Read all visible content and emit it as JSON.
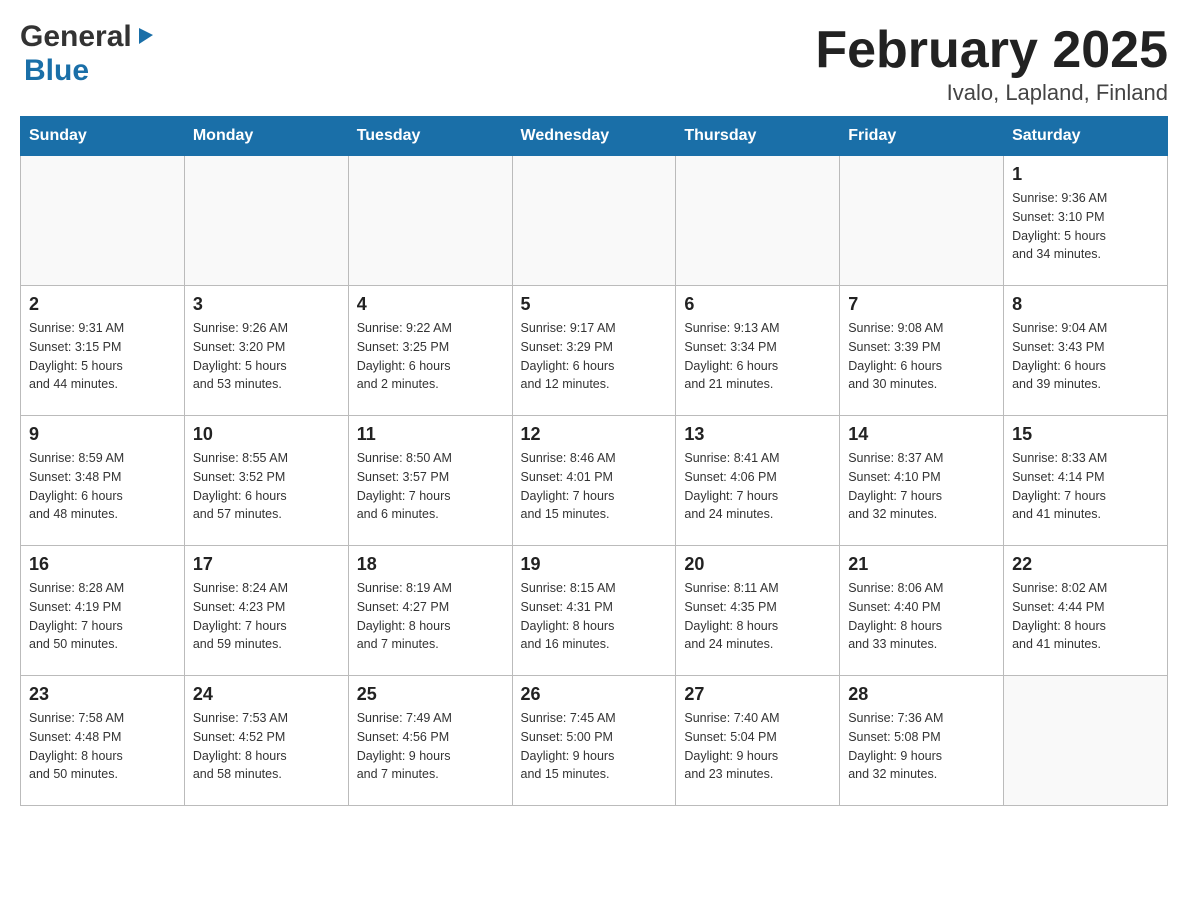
{
  "header": {
    "logo": {
      "general": "General",
      "blue": "Blue",
      "arrow_shape": "▶"
    },
    "title": "February 2025",
    "location": "Ivalo, Lapland, Finland"
  },
  "calendar": {
    "days_of_week": [
      "Sunday",
      "Monday",
      "Tuesday",
      "Wednesday",
      "Thursday",
      "Friday",
      "Saturday"
    ],
    "weeks": [
      [
        {
          "day": "",
          "info": ""
        },
        {
          "day": "",
          "info": ""
        },
        {
          "day": "",
          "info": ""
        },
        {
          "day": "",
          "info": ""
        },
        {
          "day": "",
          "info": ""
        },
        {
          "day": "",
          "info": ""
        },
        {
          "day": "1",
          "info": "Sunrise: 9:36 AM\nSunset: 3:10 PM\nDaylight: 5 hours\nand 34 minutes."
        }
      ],
      [
        {
          "day": "2",
          "info": "Sunrise: 9:31 AM\nSunset: 3:15 PM\nDaylight: 5 hours\nand 44 minutes."
        },
        {
          "day": "3",
          "info": "Sunrise: 9:26 AM\nSunset: 3:20 PM\nDaylight: 5 hours\nand 53 minutes."
        },
        {
          "day": "4",
          "info": "Sunrise: 9:22 AM\nSunset: 3:25 PM\nDaylight: 6 hours\nand 2 minutes."
        },
        {
          "day": "5",
          "info": "Sunrise: 9:17 AM\nSunset: 3:29 PM\nDaylight: 6 hours\nand 12 minutes."
        },
        {
          "day": "6",
          "info": "Sunrise: 9:13 AM\nSunset: 3:34 PM\nDaylight: 6 hours\nand 21 minutes."
        },
        {
          "day": "7",
          "info": "Sunrise: 9:08 AM\nSunset: 3:39 PM\nDaylight: 6 hours\nand 30 minutes."
        },
        {
          "day": "8",
          "info": "Sunrise: 9:04 AM\nSunset: 3:43 PM\nDaylight: 6 hours\nand 39 minutes."
        }
      ],
      [
        {
          "day": "9",
          "info": "Sunrise: 8:59 AM\nSunset: 3:48 PM\nDaylight: 6 hours\nand 48 minutes."
        },
        {
          "day": "10",
          "info": "Sunrise: 8:55 AM\nSunset: 3:52 PM\nDaylight: 6 hours\nand 57 minutes."
        },
        {
          "day": "11",
          "info": "Sunrise: 8:50 AM\nSunset: 3:57 PM\nDaylight: 7 hours\nand 6 minutes."
        },
        {
          "day": "12",
          "info": "Sunrise: 8:46 AM\nSunset: 4:01 PM\nDaylight: 7 hours\nand 15 minutes."
        },
        {
          "day": "13",
          "info": "Sunrise: 8:41 AM\nSunset: 4:06 PM\nDaylight: 7 hours\nand 24 minutes."
        },
        {
          "day": "14",
          "info": "Sunrise: 8:37 AM\nSunset: 4:10 PM\nDaylight: 7 hours\nand 32 minutes."
        },
        {
          "day": "15",
          "info": "Sunrise: 8:33 AM\nSunset: 4:14 PM\nDaylight: 7 hours\nand 41 minutes."
        }
      ],
      [
        {
          "day": "16",
          "info": "Sunrise: 8:28 AM\nSunset: 4:19 PM\nDaylight: 7 hours\nand 50 minutes."
        },
        {
          "day": "17",
          "info": "Sunrise: 8:24 AM\nSunset: 4:23 PM\nDaylight: 7 hours\nand 59 minutes."
        },
        {
          "day": "18",
          "info": "Sunrise: 8:19 AM\nSunset: 4:27 PM\nDaylight: 8 hours\nand 7 minutes."
        },
        {
          "day": "19",
          "info": "Sunrise: 8:15 AM\nSunset: 4:31 PM\nDaylight: 8 hours\nand 16 minutes."
        },
        {
          "day": "20",
          "info": "Sunrise: 8:11 AM\nSunset: 4:35 PM\nDaylight: 8 hours\nand 24 minutes."
        },
        {
          "day": "21",
          "info": "Sunrise: 8:06 AM\nSunset: 4:40 PM\nDaylight: 8 hours\nand 33 minutes."
        },
        {
          "day": "22",
          "info": "Sunrise: 8:02 AM\nSunset: 4:44 PM\nDaylight: 8 hours\nand 41 minutes."
        }
      ],
      [
        {
          "day": "23",
          "info": "Sunrise: 7:58 AM\nSunset: 4:48 PM\nDaylight: 8 hours\nand 50 minutes."
        },
        {
          "day": "24",
          "info": "Sunrise: 7:53 AM\nSunset: 4:52 PM\nDaylight: 8 hours\nand 58 minutes."
        },
        {
          "day": "25",
          "info": "Sunrise: 7:49 AM\nSunset: 4:56 PM\nDaylight: 9 hours\nand 7 minutes."
        },
        {
          "day": "26",
          "info": "Sunrise: 7:45 AM\nSunset: 5:00 PM\nDaylight: 9 hours\nand 15 minutes."
        },
        {
          "day": "27",
          "info": "Sunrise: 7:40 AM\nSunset: 5:04 PM\nDaylight: 9 hours\nand 23 minutes."
        },
        {
          "day": "28",
          "info": "Sunrise: 7:36 AM\nSunset: 5:08 PM\nDaylight: 9 hours\nand 32 minutes."
        },
        {
          "day": "",
          "info": ""
        }
      ]
    ]
  }
}
